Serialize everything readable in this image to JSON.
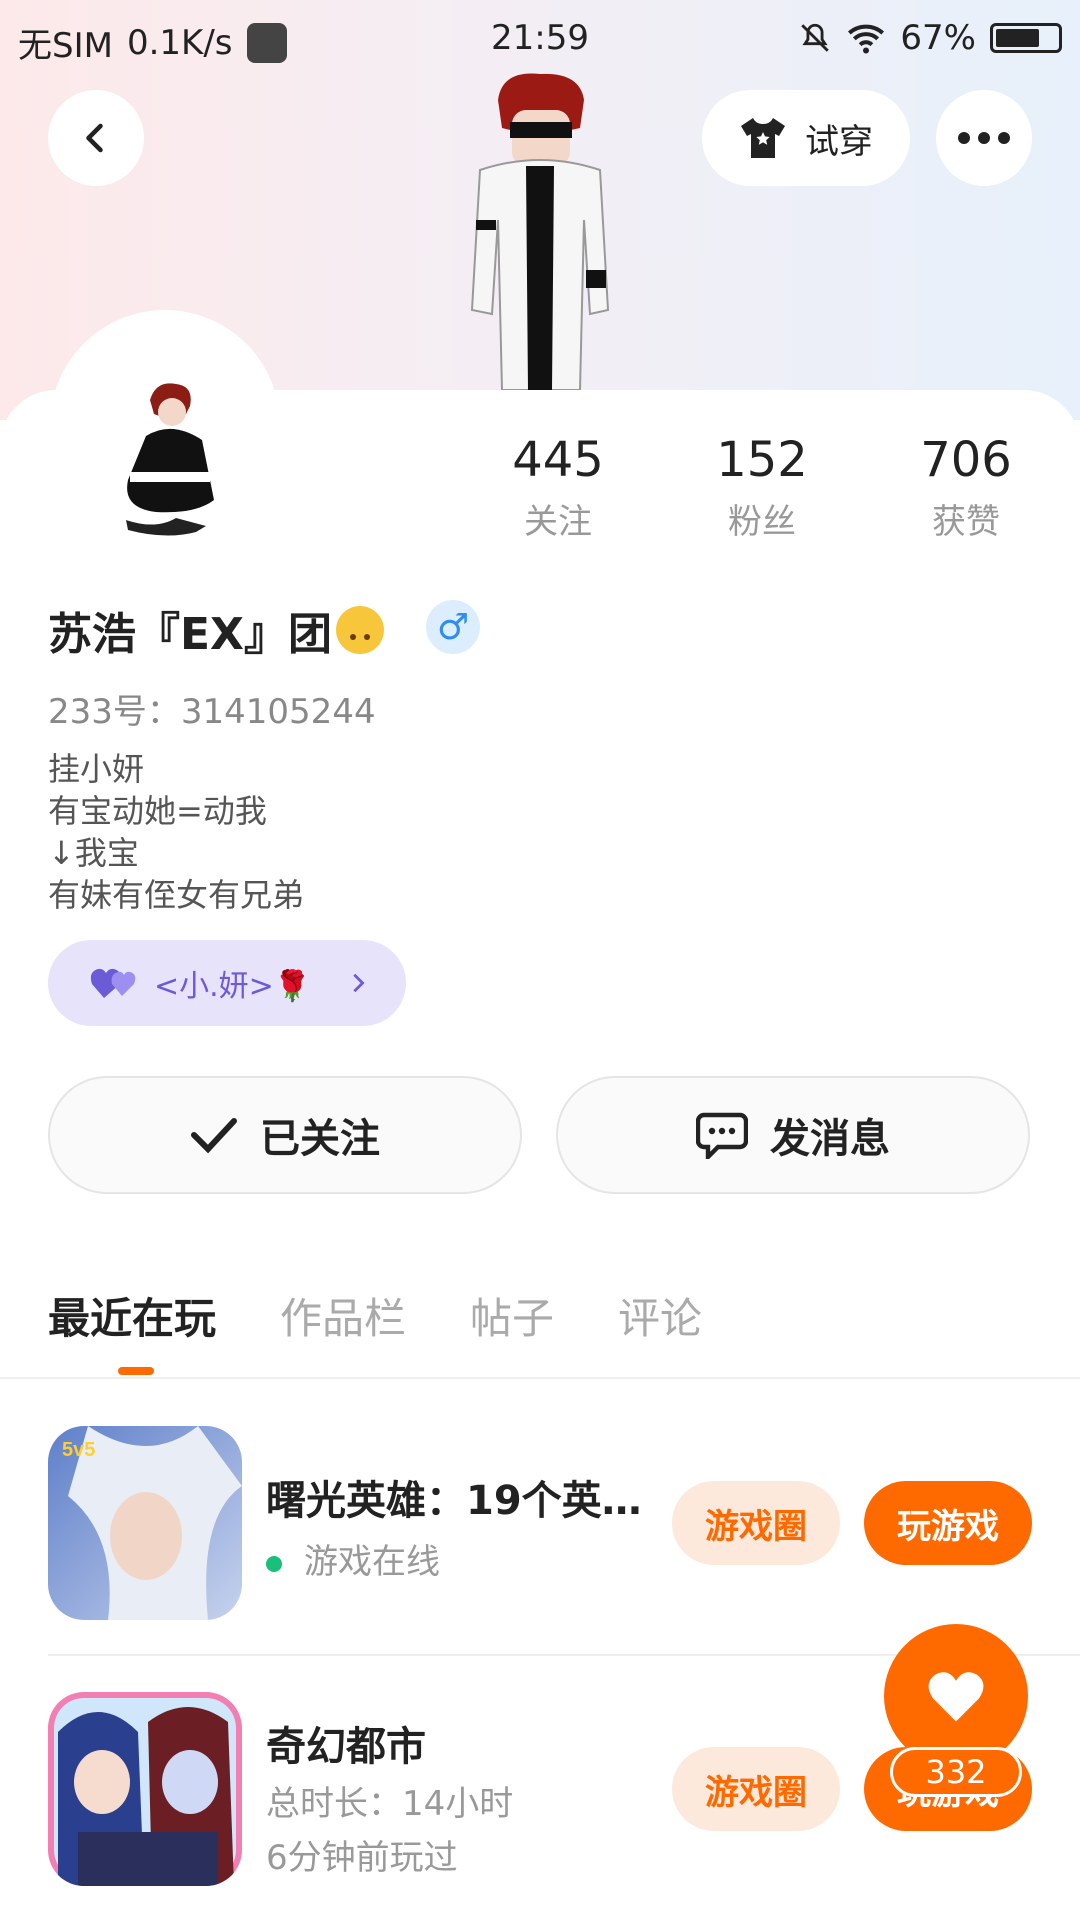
{
  "status_bar": {
    "carrier": "无SIM",
    "speed": "0.1K/s",
    "time": "21:59",
    "battery": "67%"
  },
  "header": {
    "tryon_label": "试穿"
  },
  "stats": [
    {
      "value": "445",
      "label": "关注"
    },
    {
      "value": "152",
      "label": "粉丝"
    },
    {
      "value": "706",
      "label": "获赞"
    }
  ],
  "profile": {
    "name": "苏浩『EX』团",
    "gender": "♂",
    "uid": "233号：314105244",
    "bio": [
      "挂小妍",
      "有宝动她=动我",
      "↓我宝",
      "有妹有侄女有兄弟"
    ],
    "relation_chip": "<小.妍>🌹"
  },
  "actions": {
    "followed": "已关注",
    "message": "发消息"
  },
  "tabs": [
    "最近在玩",
    "作品栏",
    "帖子",
    "评论"
  ],
  "games": [
    {
      "title": "曙光英雄：19个英…",
      "status": "游戏在线",
      "circle_label": "游戏圈",
      "play_label": "玩游戏",
      "badge": "5v5"
    },
    {
      "title": "奇幻都市",
      "duration": "总时长：14小时",
      "last_played": "6分钟前玩过",
      "circle_label": "游戏圈",
      "play_label": "玩游戏"
    }
  ],
  "fab": {
    "count": "332"
  },
  "colors": {
    "accent": "#ff6a00",
    "online": "#19c07b",
    "chip": "#6b5bd6"
  }
}
